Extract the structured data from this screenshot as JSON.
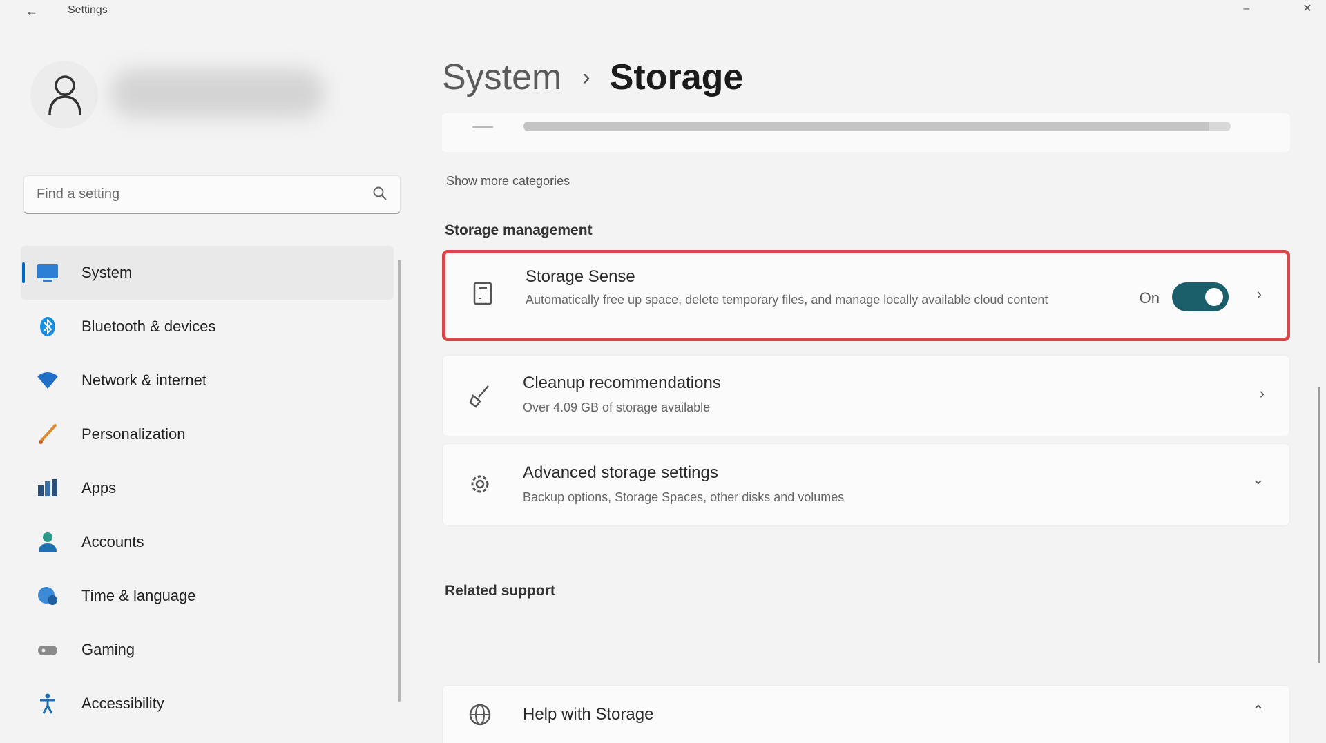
{
  "window": {
    "app_title": "Settings",
    "back_icon": "back-arrow-icon",
    "min_glyph": "–",
    "close_glyph": "✕"
  },
  "sidebar": {
    "search_placeholder": "Find a setting",
    "items": [
      {
        "label": "System",
        "icon": "system-icon",
        "active": true
      },
      {
        "label": "Bluetooth & devices",
        "icon": "bluetooth-icon",
        "active": false
      },
      {
        "label": "Network & internet",
        "icon": "network-icon",
        "active": false
      },
      {
        "label": "Personalization",
        "icon": "brush-icon",
        "active": false
      },
      {
        "label": "Apps",
        "icon": "apps-icon",
        "active": false
      },
      {
        "label": "Accounts",
        "icon": "accounts-icon",
        "active": false
      },
      {
        "label": "Time & language",
        "icon": "globe-clock-icon",
        "active": false
      },
      {
        "label": "Gaming",
        "icon": "gamepad-icon",
        "active": false
      },
      {
        "label": "Accessibility",
        "icon": "accessibility-icon",
        "active": false
      }
    ]
  },
  "main": {
    "breadcrumb": {
      "parent": "System",
      "separator": "›",
      "current": "Storage"
    },
    "usage_fraction": 0.97,
    "more_link": "Show more categories",
    "storage_management": {
      "title": "Storage management",
      "storage_sense": {
        "title": "Storage Sense",
        "description": "Automatically free up space, delete temporary files, and manage locally available cloud content",
        "toggle_label": "On",
        "toggle_on": true,
        "chevron": "›",
        "icon": "storage-sense-icon"
      },
      "cleanup": {
        "title": "Cleanup recommendations",
        "description": "Over 4.09 GB of storage available",
        "chevron": "›",
        "icon": "broom-icon"
      },
      "advanced": {
        "title": "Advanced storage settings",
        "description": "Backup options, Storage Spaces, other disks and volumes",
        "chevron": "⌄",
        "icon": "gear-icon"
      }
    },
    "related_support": {
      "title": "Related support",
      "help": {
        "title": "Help with Storage",
        "chevron": "⌃",
        "icon": "globe-icon"
      }
    }
  },
  "colors": {
    "accent": "#0067c0",
    "toggle_on": "#1b5f6a",
    "highlight_border": "#d9464b"
  }
}
